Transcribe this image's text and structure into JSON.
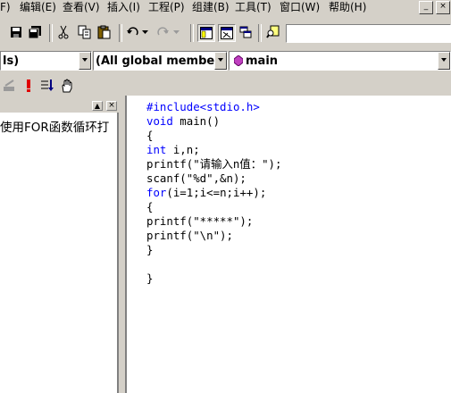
{
  "menu": {
    "file_partial": "F)",
    "edit": "编辑(E)",
    "view": "查看(V)",
    "insert": "插入(I)",
    "project": "工程(P)",
    "build": "组建(B)",
    "tools": "工具(T)",
    "window": "窗口(W)",
    "help": "帮助(H)"
  },
  "window_controls": {
    "minimize": "_",
    "close": "×"
  },
  "toolbar": {
    "search_value": ""
  },
  "wizard_bar": {
    "class_combo": "ls)",
    "filter_combo": "(All global members",
    "member_combo": "main"
  },
  "workspace": {
    "tree_item": "使用FOR函数循环打"
  },
  "editor": {
    "lines": [
      "#include<stdio.h>",
      "void main()",
      "{",
      "int i,n;",
      "printf(\"请输入n值：\");",
      "scanf(\"%d\",&n);",
      "for(i=1;i<=n;i++);",
      "{",
      "printf(\"*****\");",
      "printf(\"\\n\");",
      "}",
      "",
      "}"
    ],
    "keyword_color": "#0000ff"
  }
}
